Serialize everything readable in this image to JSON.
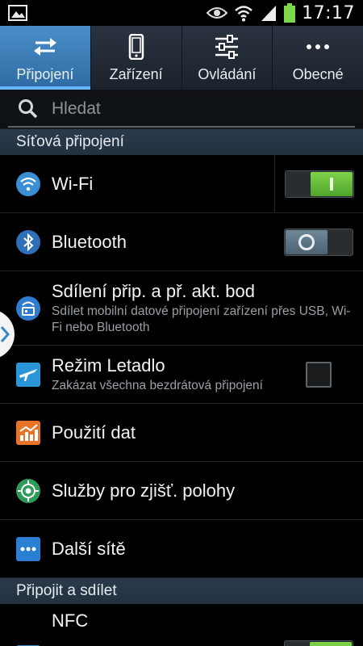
{
  "status_bar": {
    "time": "17:17",
    "battery_percent": 100,
    "icons": [
      "image-icon",
      "eye-icon",
      "wifi-icon",
      "signal-icon",
      "battery-icon"
    ]
  },
  "tabs": [
    {
      "label": "Připojení",
      "icon": "arrows-swap-icon",
      "active": true
    },
    {
      "label": "Zařízení",
      "icon": "phone-icon",
      "active": false
    },
    {
      "label": "Ovládání",
      "icon": "sliders-icon",
      "active": false
    },
    {
      "label": "Obecné",
      "icon": "more-icon",
      "active": false
    }
  ],
  "search": {
    "placeholder": "Hledat"
  },
  "sections": {
    "network": "Síťová připojení",
    "connect_share": "Připojit a sdílet"
  },
  "rows": {
    "wifi": {
      "title": "Wi-Fi",
      "toggle": "on"
    },
    "bluetooth": {
      "title": "Bluetooth",
      "toggle": "off"
    },
    "tethering": {
      "title": "Sdílení přip. a př. akt. bod",
      "subtitle": "Sdílet mobilní datové připojení zařízení přes USB, Wi-Fi nebo Bluetooth"
    },
    "airplane": {
      "title": "Režim Letadlo",
      "subtitle": "Zakázat všechna bezdrátová připojení",
      "checked": false
    },
    "data_usage": {
      "title": "Použití dat"
    },
    "location": {
      "title": "Služby pro zjišť. polohy"
    },
    "more_networks": {
      "title": "Další sítě"
    },
    "nfc": {
      "title": "NFC",
      "subtitle": "",
      "toggle": "on"
    }
  },
  "colors": {
    "accent": "#3a86c8",
    "toggle_on": "#5fbf33",
    "section_bg": "#28394a"
  }
}
